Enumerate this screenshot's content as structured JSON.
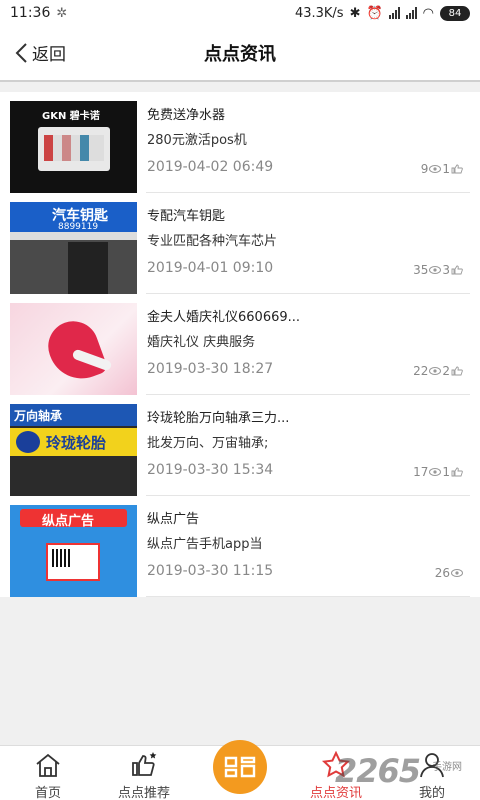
{
  "status": {
    "time": "11:36",
    "speed": "43.3K/s",
    "battery": "84"
  },
  "header": {
    "back_label": "返回",
    "title": "点点资讯"
  },
  "items": [
    {
      "line1": "免费送净水器",
      "line2": "280元激活pos机",
      "date": "2019-04-02 06:49",
      "views": "9",
      "likes": "1",
      "thumb_text": "GKN 碧卡诺"
    },
    {
      "line1": "专配汽车钥匙",
      "line2": "专业匹配各种汽车芯片",
      "date": "2019-04-01 09:10",
      "views": "35",
      "likes": "3",
      "thumb_text": "汽车钥匙",
      "thumb_text2": "8899119"
    },
    {
      "line1": "金夫人婚庆礼仪660669...",
      "line2": "婚庆礼仪 庆典服务",
      "date": "2019-03-30 18:27",
      "views": "22",
      "likes": "2"
    },
    {
      "line1": "玲珑轮胎万向轴承三力...",
      "line2": "批发万向、万宙轴承;",
      "date": "2019-03-30 15:34",
      "views": "17",
      "likes": "1",
      "thumb_text": "万向轴承",
      "thumb_text2": "玲珑轮胎"
    },
    {
      "line1": "纵点广告",
      "line2": "纵点广告手机app当",
      "date": "2019-03-30 11:15",
      "views": "26",
      "likes": "",
      "thumb_text": "纵点广告"
    }
  ],
  "tabs": [
    {
      "label": "首页"
    },
    {
      "label": "点点推荐"
    },
    {
      "label": ""
    },
    {
      "label": "点点资讯"
    },
    {
      "label": "我的"
    }
  ],
  "watermark": {
    "text": "2265",
    "sub": "手游网"
  },
  "colors": {
    "accent": "#e03b3b",
    "center": "#f39a1f"
  }
}
